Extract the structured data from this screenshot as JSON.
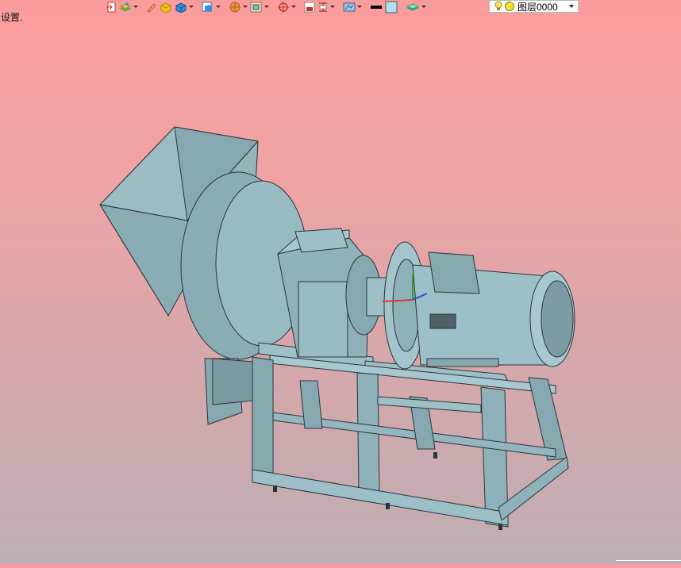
{
  "status": {
    "text": "设置."
  },
  "toolbar": {
    "buttons": [
      {
        "icon": "insert-icon",
        "dropdown": false
      },
      {
        "icon": "layers-stack-icon",
        "dropdown": true
      },
      {
        "icon": "pencil-icon",
        "dropdown": false
      },
      {
        "icon": "solid-box-icon",
        "dropdown": false
      },
      {
        "icon": "blue-cube-icon",
        "dropdown": true
      },
      {
        "icon": "feature-cube-icon",
        "dropdown": true
      },
      {
        "icon": "render-sphere-icon",
        "dropdown": true
      },
      {
        "icon": "view-frame-icon",
        "dropdown": true
      },
      {
        "icon": "snap-target-icon",
        "dropdown": true
      },
      {
        "icon": "section-icon",
        "dropdown": false
      },
      {
        "icon": "dimension-icon",
        "dropdown": true
      },
      {
        "icon": "visual-style-icon",
        "dropdown": true
      },
      {
        "icon": "line-color-swatch-icon",
        "dropdown": false
      },
      {
        "icon": "fill-color-swatch-icon",
        "dropdown": false
      },
      {
        "icon": "material-icon",
        "dropdown": true
      }
    ],
    "colors": {
      "line": "#000000",
      "fill": "#aee1f2"
    }
  },
  "layer": {
    "label": "图层0000"
  },
  "viewport": {
    "background_top": "#fb9c9c",
    "background_bottom": "#bdaeb3",
    "model_color": "#8fb2bb"
  }
}
